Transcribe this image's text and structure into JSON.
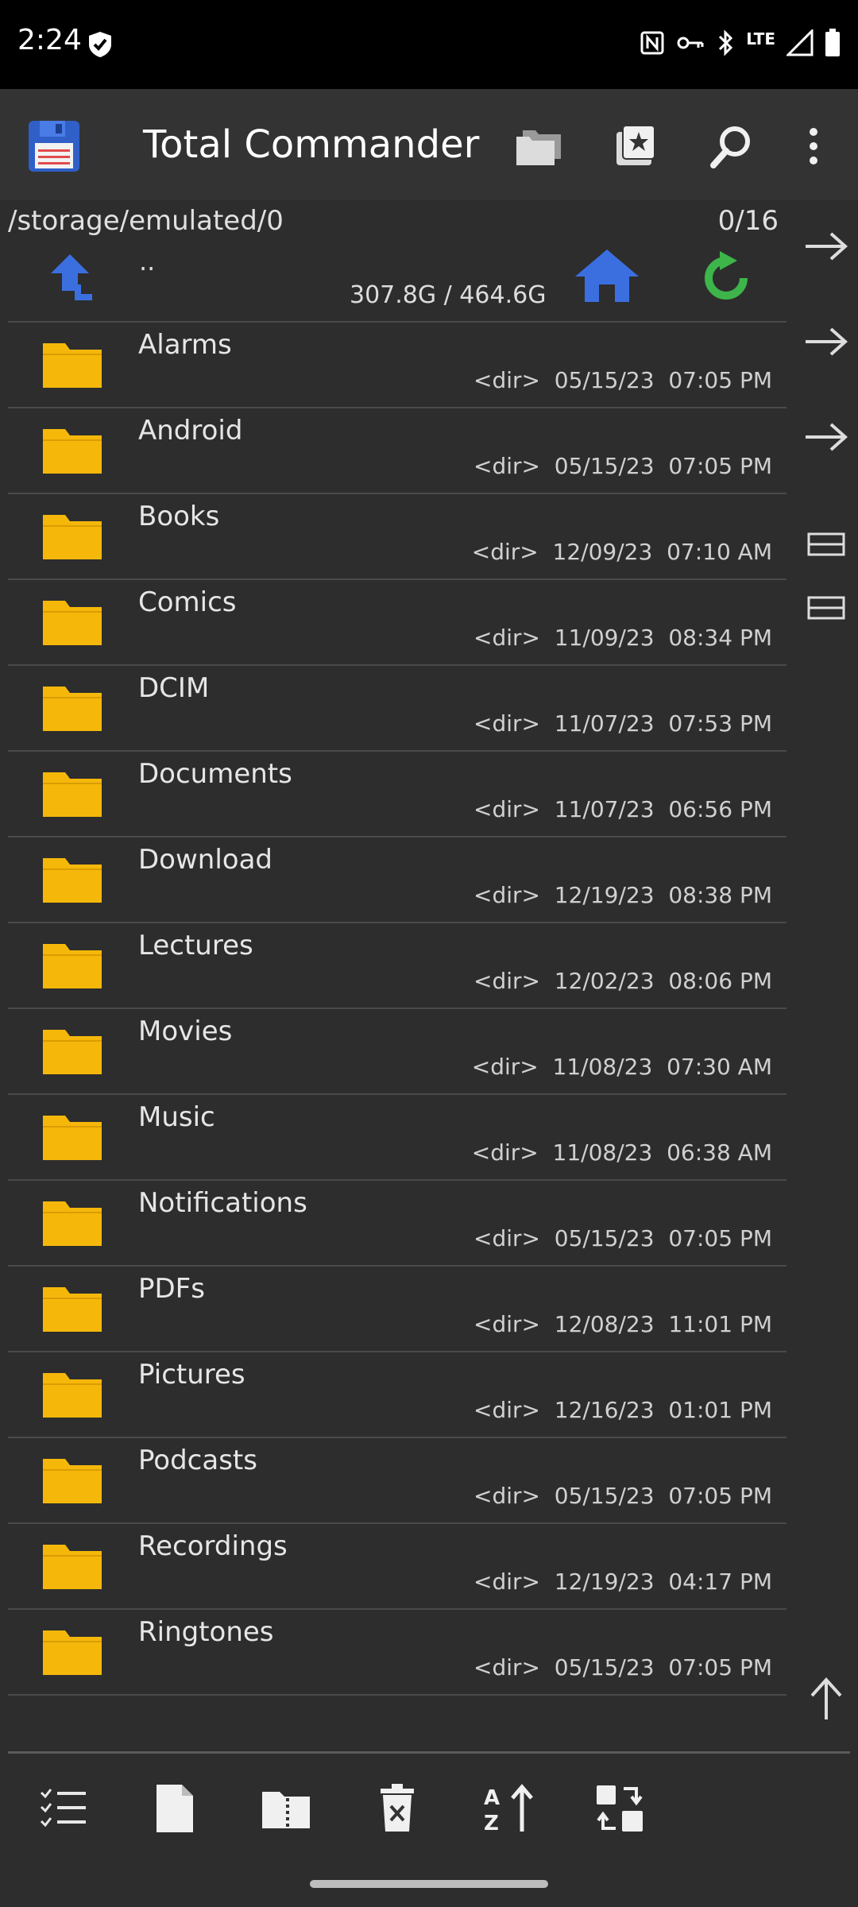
{
  "status": {
    "time": "2:24",
    "icons": [
      "shield-check-icon",
      "nfc-icon",
      "vpn-key-icon",
      "bluetooth-icon",
      "lte-icon",
      "signal-icon",
      "battery-icon"
    ],
    "lte_label": "LTE"
  },
  "app": {
    "title": "Total Commander",
    "icons": [
      "floppy-disk-icon",
      "folders-icon",
      "bookmark-star-icon",
      "search-icon",
      "more-vert-icon"
    ]
  },
  "panel": {
    "path": "/storage/emulated/0",
    "count": "0/16",
    "updir": "..",
    "space": "307.8G / 464.6G"
  },
  "files": [
    {
      "name": "Alarms",
      "meta": "<dir>  05/15/23  07:05 PM"
    },
    {
      "name": "Android",
      "meta": "<dir>  05/15/23  07:05 PM"
    },
    {
      "name": "Books",
      "meta": "<dir>  12/09/23  07:10 AM"
    },
    {
      "name": "Comics",
      "meta": "<dir>  11/09/23  08:34 PM"
    },
    {
      "name": "DCIM",
      "meta": "<dir>  11/07/23  07:53 PM"
    },
    {
      "name": "Documents",
      "meta": "<dir>  11/07/23  06:56 PM"
    },
    {
      "name": "Download",
      "meta": "<dir>  12/19/23  08:38 PM"
    },
    {
      "name": "Lectures",
      "meta": "<dir>  12/02/23  08:06 PM"
    },
    {
      "name": "Movies",
      "meta": "<dir>  11/08/23  07:30 AM"
    },
    {
      "name": "Music",
      "meta": "<dir>  11/08/23  06:38 AM"
    },
    {
      "name": "Notifications",
      "meta": "<dir>  05/15/23  07:05 PM"
    },
    {
      "name": "PDFs",
      "meta": "<dir>  12/08/23  11:01 PM"
    },
    {
      "name": "Pictures",
      "meta": "<dir>  12/16/23  01:01 PM"
    },
    {
      "name": "Podcasts",
      "meta": "<dir>  05/15/23  07:05 PM"
    },
    {
      "name": "Recordings",
      "meta": "<dir>  12/19/23  04:17 PM"
    },
    {
      "name": "Ringtones",
      "meta": "<dir>  05/15/23  07:05 PM"
    }
  ],
  "colors": {
    "folder": "#f5b80a",
    "accent_blue": "#3b6fe0",
    "refresh_green": "#3db54a",
    "background": "#2d2d2d"
  }
}
